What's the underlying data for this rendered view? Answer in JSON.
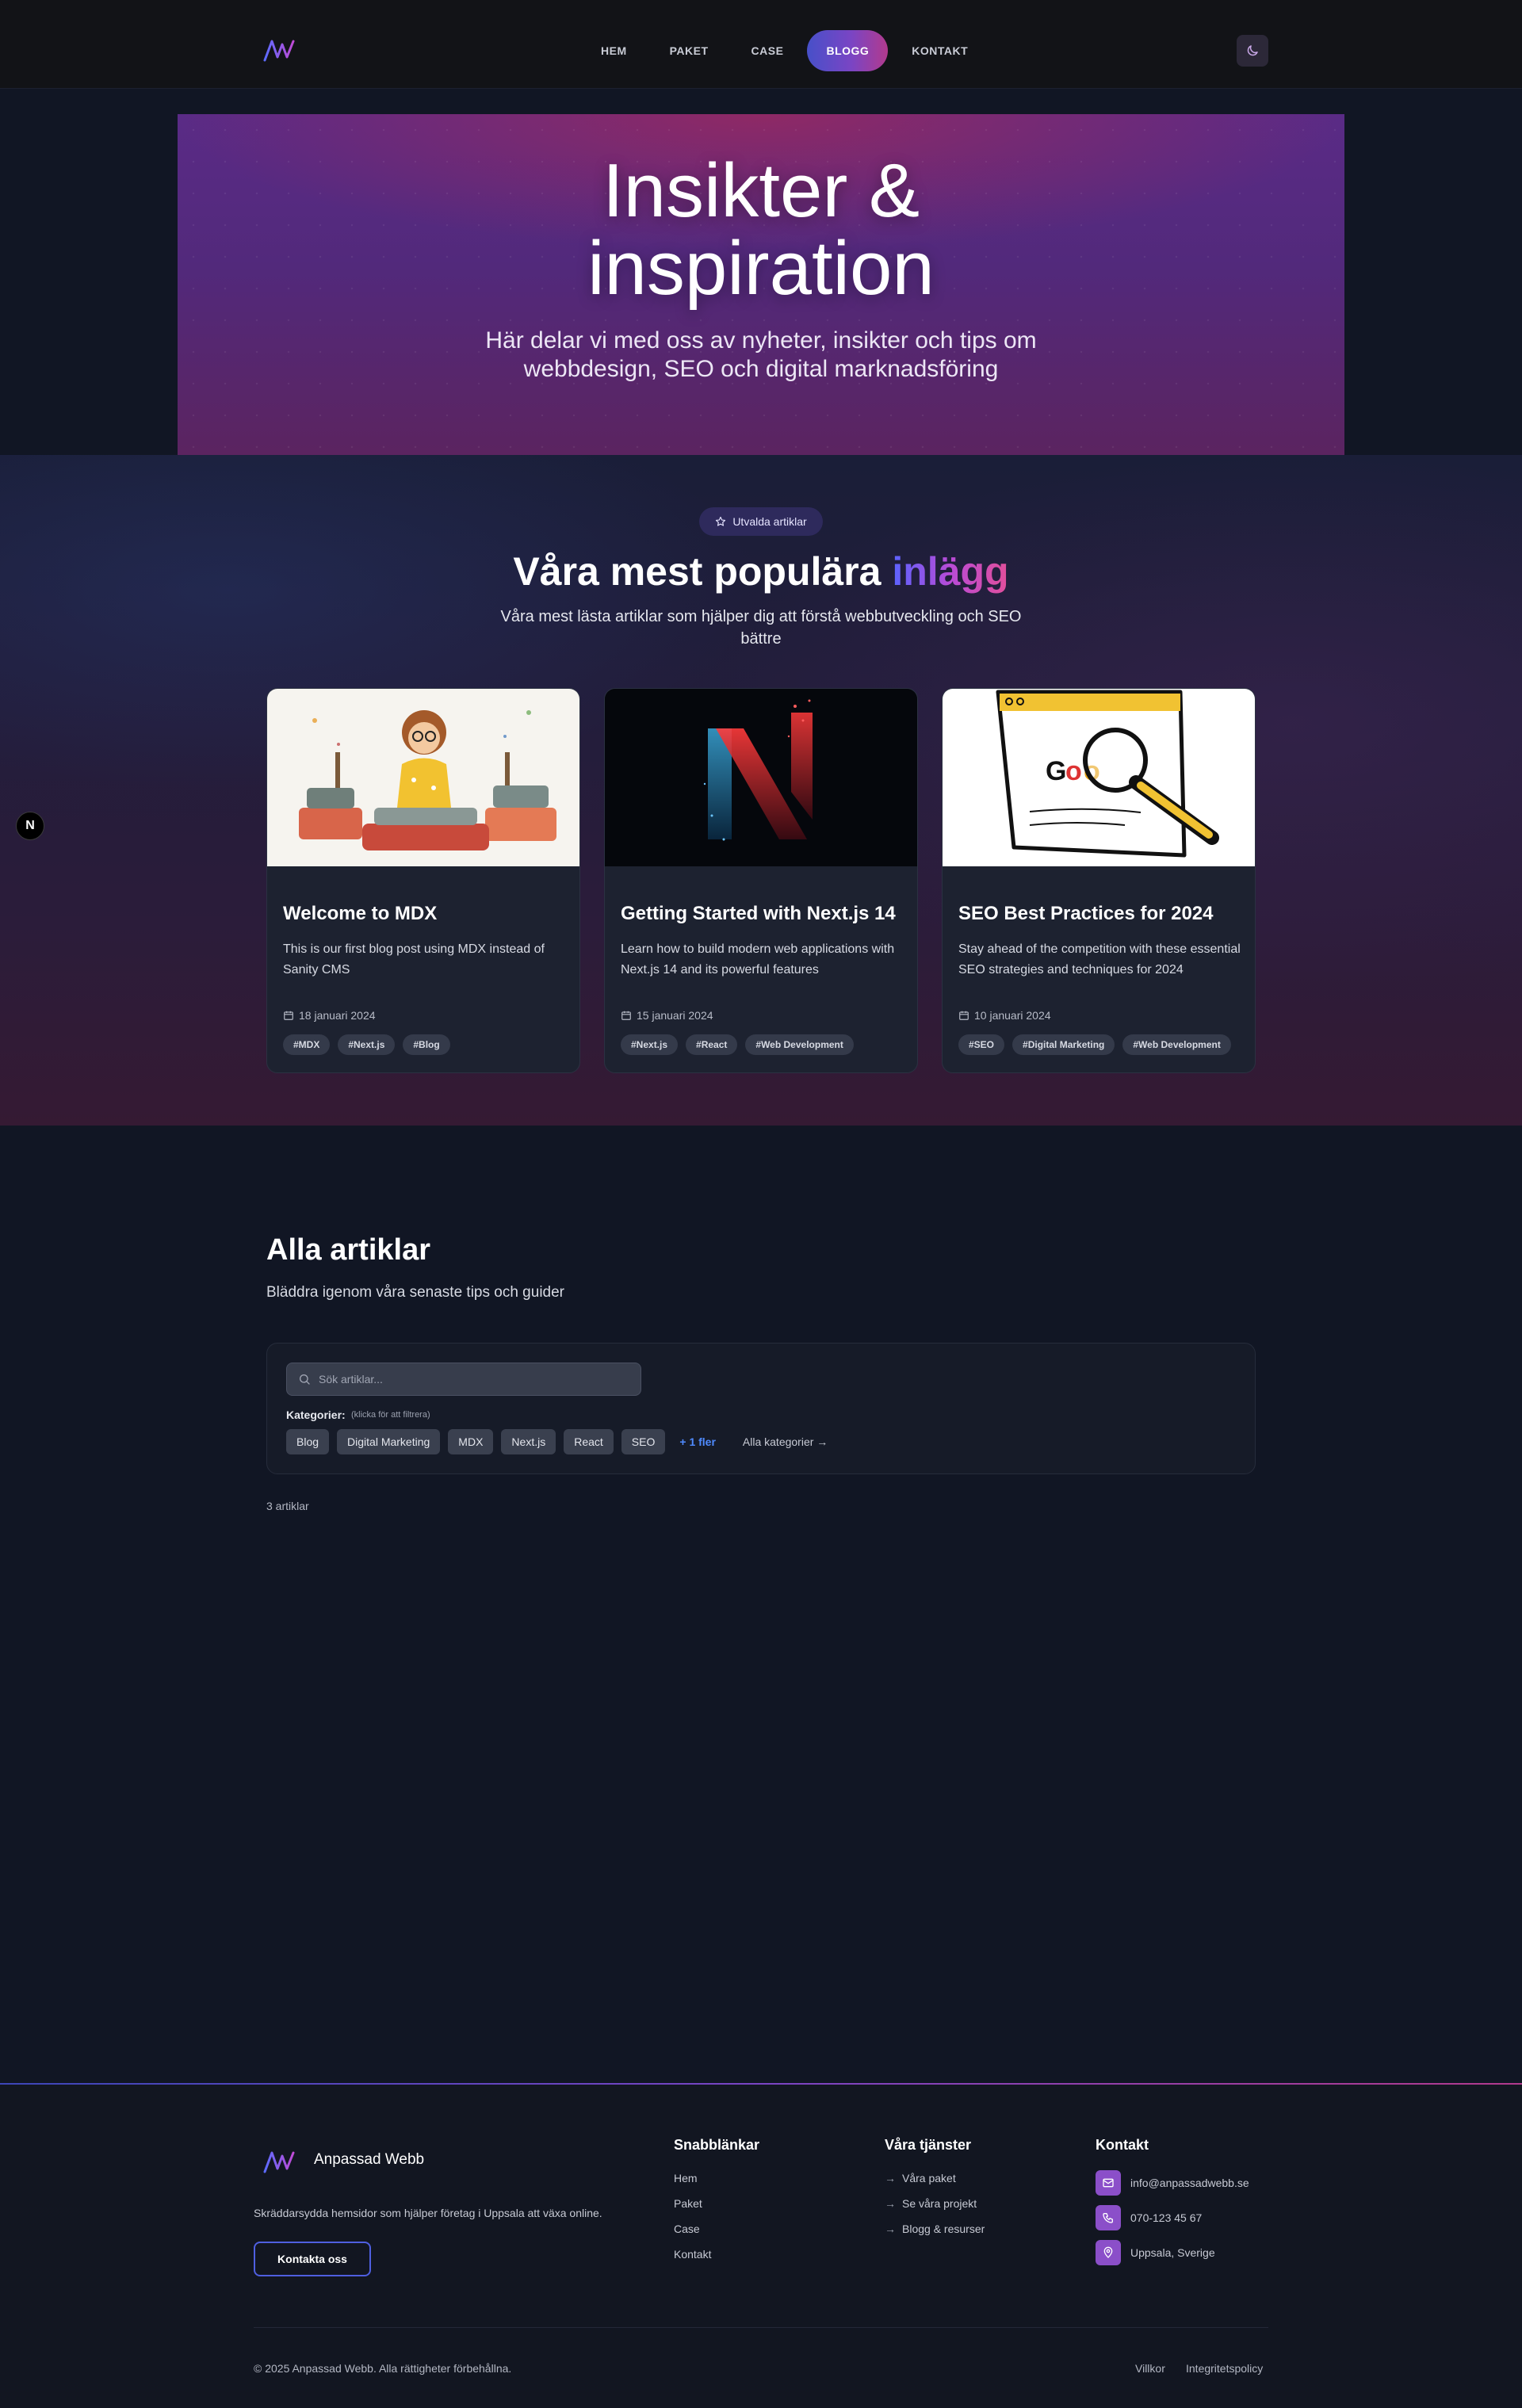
{
  "nav": {
    "logo": "AW",
    "links": [
      "HEM",
      "PAKET",
      "CASE",
      "BLOGG",
      "KONTAKT"
    ],
    "active": "BLOGG",
    "theme_icon": "moon-icon"
  },
  "hero": {
    "title_line1": "Insikter &",
    "title_line2": "inspiration",
    "subtitle_line1": "Här delar vi med oss av nyheter, insikter och tips om",
    "subtitle_line2": "webbdesign, SEO och digital marknadsföring"
  },
  "popular": {
    "badge": "Utvalda artiklar",
    "title_main": "Våra mest populära ",
    "title_accent": "inlägg",
    "subtitle": "Våra mest lästa artiklar som hjälper dig att förstå webbutveckling och SEO bättre",
    "cards": [
      {
        "title": "Welcome to MDX",
        "desc": "This is our first blog post using MDX instead of Sanity CMS",
        "date": "18 januari 2024",
        "tags": [
          "#MDX",
          "#Next.js",
          "#Blog"
        ]
      },
      {
        "title": "Getting Started with Next.js 14",
        "desc": "Learn how to build modern web applications with Next.js 14 and its powerful features",
        "date": "15 januari 2024",
        "tags": [
          "#Next.js",
          "#React",
          "#Web Development"
        ]
      },
      {
        "title": "SEO Best Practices for 2024",
        "desc": "Stay ahead of the competition with these essential SEO strategies and techniques for 2024",
        "date": "10 januari 2024",
        "tags": [
          "#SEO",
          "#Digital Marketing",
          "#Web Development"
        ]
      }
    ]
  },
  "next_badge": "N",
  "all": {
    "title": "Alla artiklar",
    "subtitle": "Bläddra igenom våra senaste tips och guider",
    "search_placeholder": "Sök artiklar...",
    "categories_label": "Kategorier:",
    "categories_hint": "(klicka för att filtrera)",
    "categories": [
      "Blog",
      "Digital Marketing",
      "MDX",
      "Next.js",
      "React",
      "SEO"
    ],
    "more": "+ 1 fler",
    "all_categories": "Alla kategorier →",
    "count": "3 artiklar"
  },
  "footer": {
    "brand": "Anpassad Webb",
    "desc": "Skräddarsydda hemsidor som hjälper företag i Uppsala att växa online.",
    "cta": "Kontakta oss",
    "quick_title": "Snabblänkar",
    "quick_links": [
      "Hem",
      "Paket",
      "Case",
      "Kontakt"
    ],
    "services_title": "Våra tjänster",
    "services": [
      "Våra paket",
      "Se våra projekt",
      "Blogg & resurser"
    ],
    "contact_title": "Kontakt",
    "email": "info@anpassadwebb.se",
    "phone": "070-123 45 67",
    "location": "Uppsala, Sverige",
    "copyright": "© 2025 Anpassad Webb. Alla rättigheter förbehållna.",
    "terms": "Villkor",
    "privacy": "Integritetspolicy"
  },
  "colors": {
    "accent_start": "#4750c9",
    "accent_mid": "#7a45c4",
    "accent_end": "#b23a8d",
    "contact_icon_bg": "#8b4fc9"
  }
}
